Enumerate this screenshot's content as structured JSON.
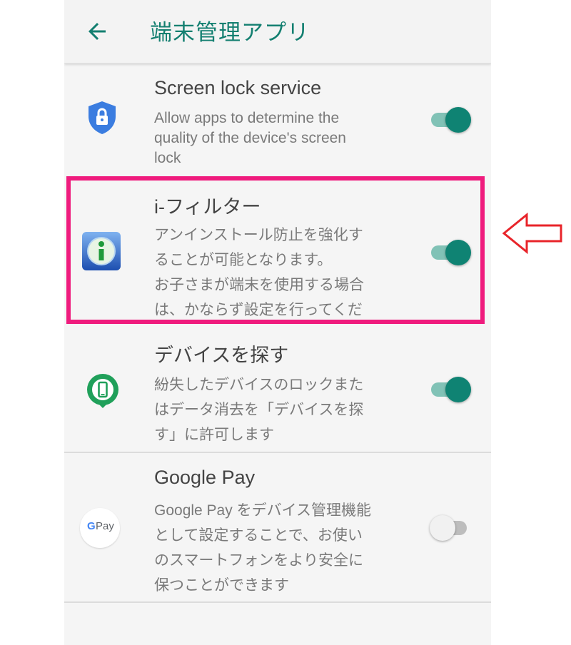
{
  "header": {
    "title": "端末管理アプリ",
    "back_icon": "arrow-back-icon"
  },
  "apps": [
    {
      "name": "Screen lock service",
      "icon": "shield-lock-icon",
      "description_lines": [
        "Allow apps to determine the",
        "quality of the device's screen",
        "lock"
      ],
      "enabled": true
    },
    {
      "name": "i-フィルター",
      "icon": "i-filter-app-icon",
      "description_lines": [
        "アンインストール防止を強化す",
        "ることが可能となります。",
        "お子さまが端末を使用する場合",
        "は、かならず設定を行ってくだ"
      ],
      "enabled": true,
      "highlighted": true
    },
    {
      "name": "デバイスを探す",
      "icon": "find-device-icon",
      "description_lines": [
        "紛失したデバイスのロックまた",
        "はデータ消去を「デバイスを探",
        "す」に許可します"
      ],
      "enabled": true
    },
    {
      "name": "Google Pay",
      "icon": "google-pay-icon",
      "icon_text": "Pay",
      "icon_letter": "G",
      "description_lines": [
        "Google Pay をデバイス管理機能",
        "として設定することで、お使い",
        "のスマートフォンをより安全に",
        "保つことができます"
      ],
      "enabled": false
    }
  ],
  "colors": {
    "accent": "#0f8373",
    "highlight": "#ef1b7d",
    "arrow": "#e8242a"
  }
}
